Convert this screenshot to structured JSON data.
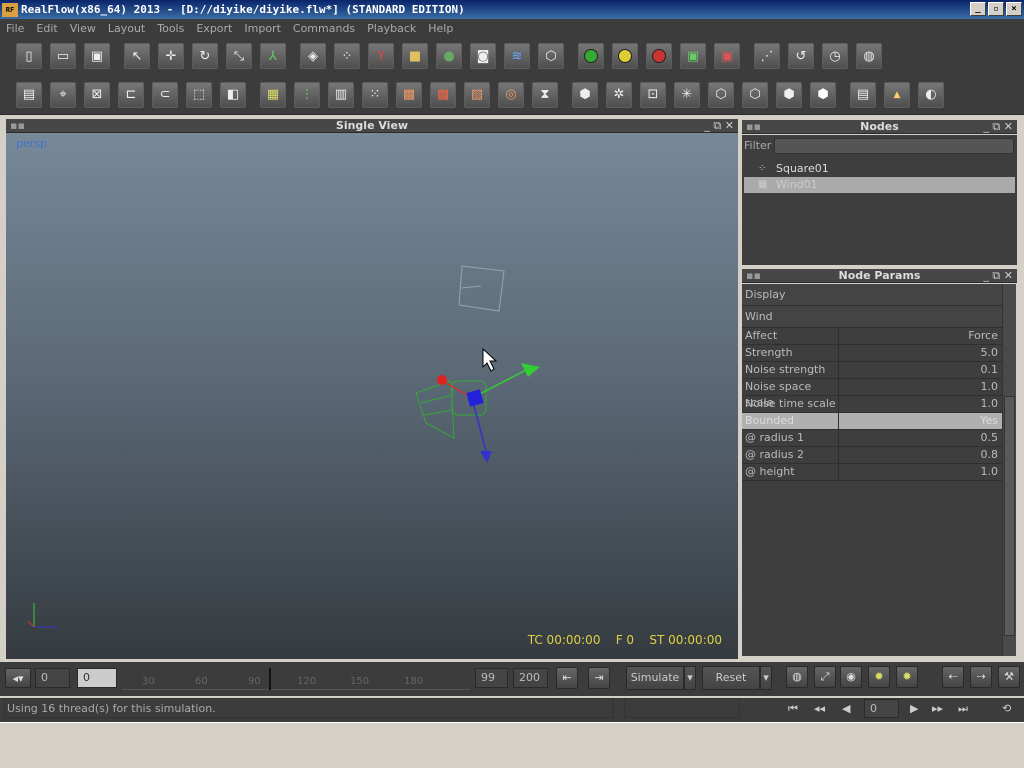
{
  "window": {
    "title": "RealFlow(x86_64) 2013 - [D://diyike/diyike.flw*] (STANDARD EDITION)",
    "app_icon": "RF"
  },
  "menu": [
    "File",
    "Edit",
    "View",
    "Layout",
    "Tools",
    "Export",
    "Import",
    "Commands",
    "Playback",
    "Help"
  ],
  "viewport": {
    "title": "Single View",
    "camera": "persp",
    "tc": "TC 00:00:00",
    "frame": "F 0",
    "st": "ST 00:00:00"
  },
  "nodes": {
    "title": "Nodes",
    "filter_label": "Filter",
    "items": [
      {
        "label": "Square01"
      },
      {
        "label": "Wind01"
      }
    ]
  },
  "params": {
    "title": "Node Params",
    "sections": [
      "Display",
      "Wind"
    ],
    "rows": [
      {
        "key": "Affect",
        "value": "Force"
      },
      {
        "key": "Strength",
        "value": "5.0"
      },
      {
        "key": "Noise strength",
        "value": "0.1"
      },
      {
        "key": "Noise space scale",
        "value": "1.0"
      },
      {
        "key": "Noise time scale",
        "value": "1.0"
      },
      {
        "key": "Bounded",
        "value": "Yes"
      },
      {
        "key": "@ radius 1",
        "value": "0.5"
      },
      {
        "key": "@ radius 2",
        "value": "0.8"
      },
      {
        "key": "@ height",
        "value": "1.0"
      }
    ]
  },
  "timeline": {
    "start": "0",
    "current": "0",
    "ticks": [
      "30",
      "60",
      "90",
      "120",
      "150",
      "180"
    ],
    "end_view": "99",
    "end": "200",
    "simulate_label": "Simulate",
    "reset_label": "Reset"
  },
  "status": {
    "message": "Using 16 thread(s) for this simulation.",
    "frame_field": "0"
  }
}
